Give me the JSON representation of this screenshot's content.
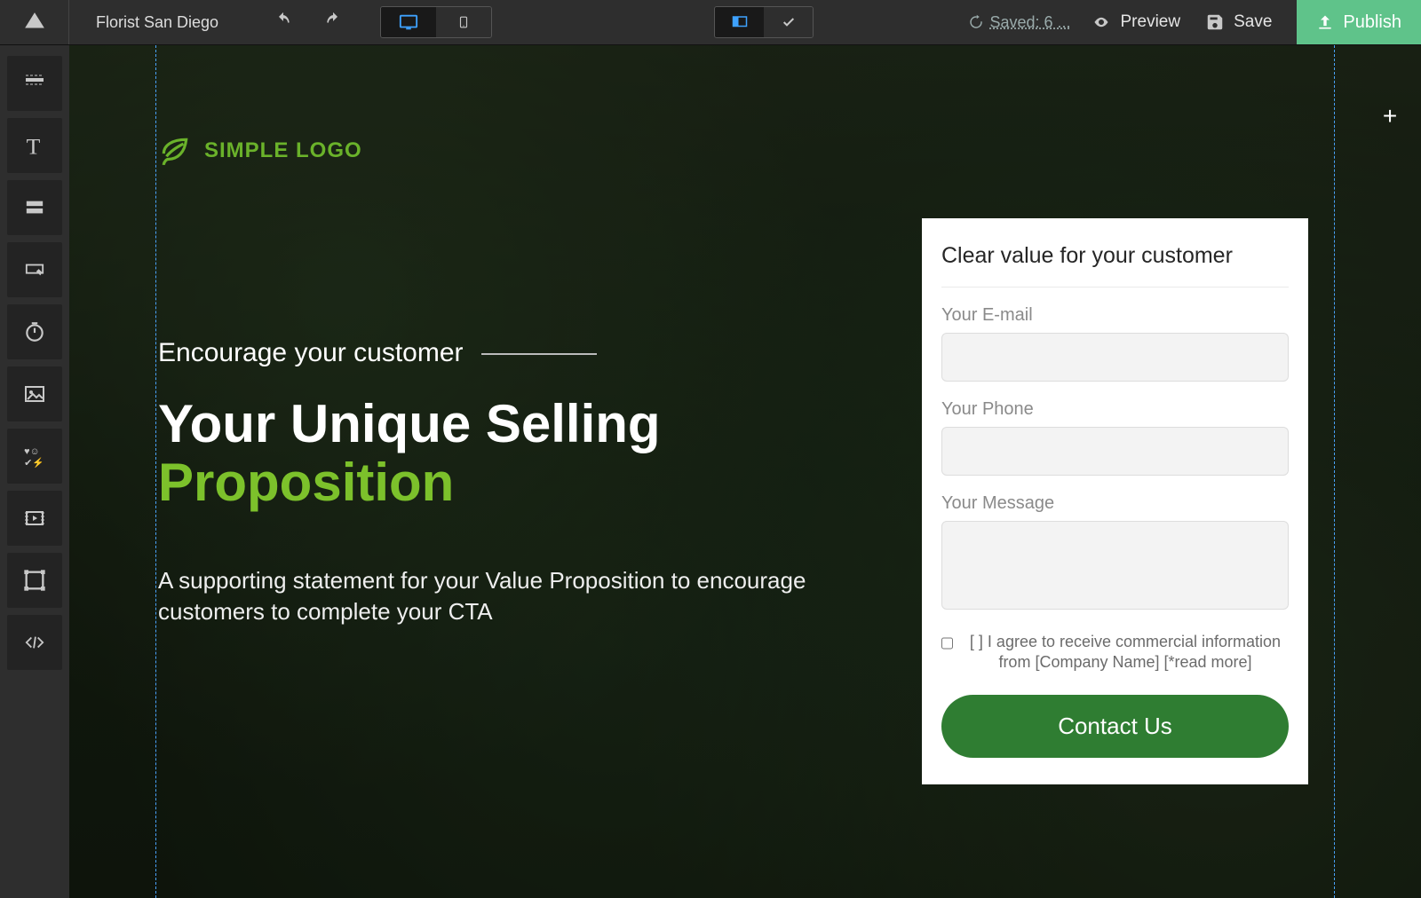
{
  "topbar": {
    "siteName": "Florist San Diego",
    "savedStatus": " Saved: 6 ...",
    "previewLabel": "Preview",
    "saveLabel": "Save",
    "publishLabel": "Publish"
  },
  "page": {
    "logoText": "SIMPLE LOGO",
    "kicker": "Encourage your customer",
    "headlineLine1": "Your Unique Selling",
    "headlineLine2": "Proposition",
    "subhead": "A supporting statement for your Value Proposition to encourage customers to complete your CTA"
  },
  "form": {
    "title": "Clear value for your customer",
    "emailLabel": "Your E-mail",
    "phoneLabel": "Your Phone",
    "messageLabel": "Your Message",
    "consentText": "[ ] I agree to receive commercial information from [Company Name] [*read more]",
    "submitLabel": "Contact Us"
  },
  "colors": {
    "accent": "#7cc12b",
    "publish": "#5fc38a",
    "formButton": "#2f7d32"
  }
}
